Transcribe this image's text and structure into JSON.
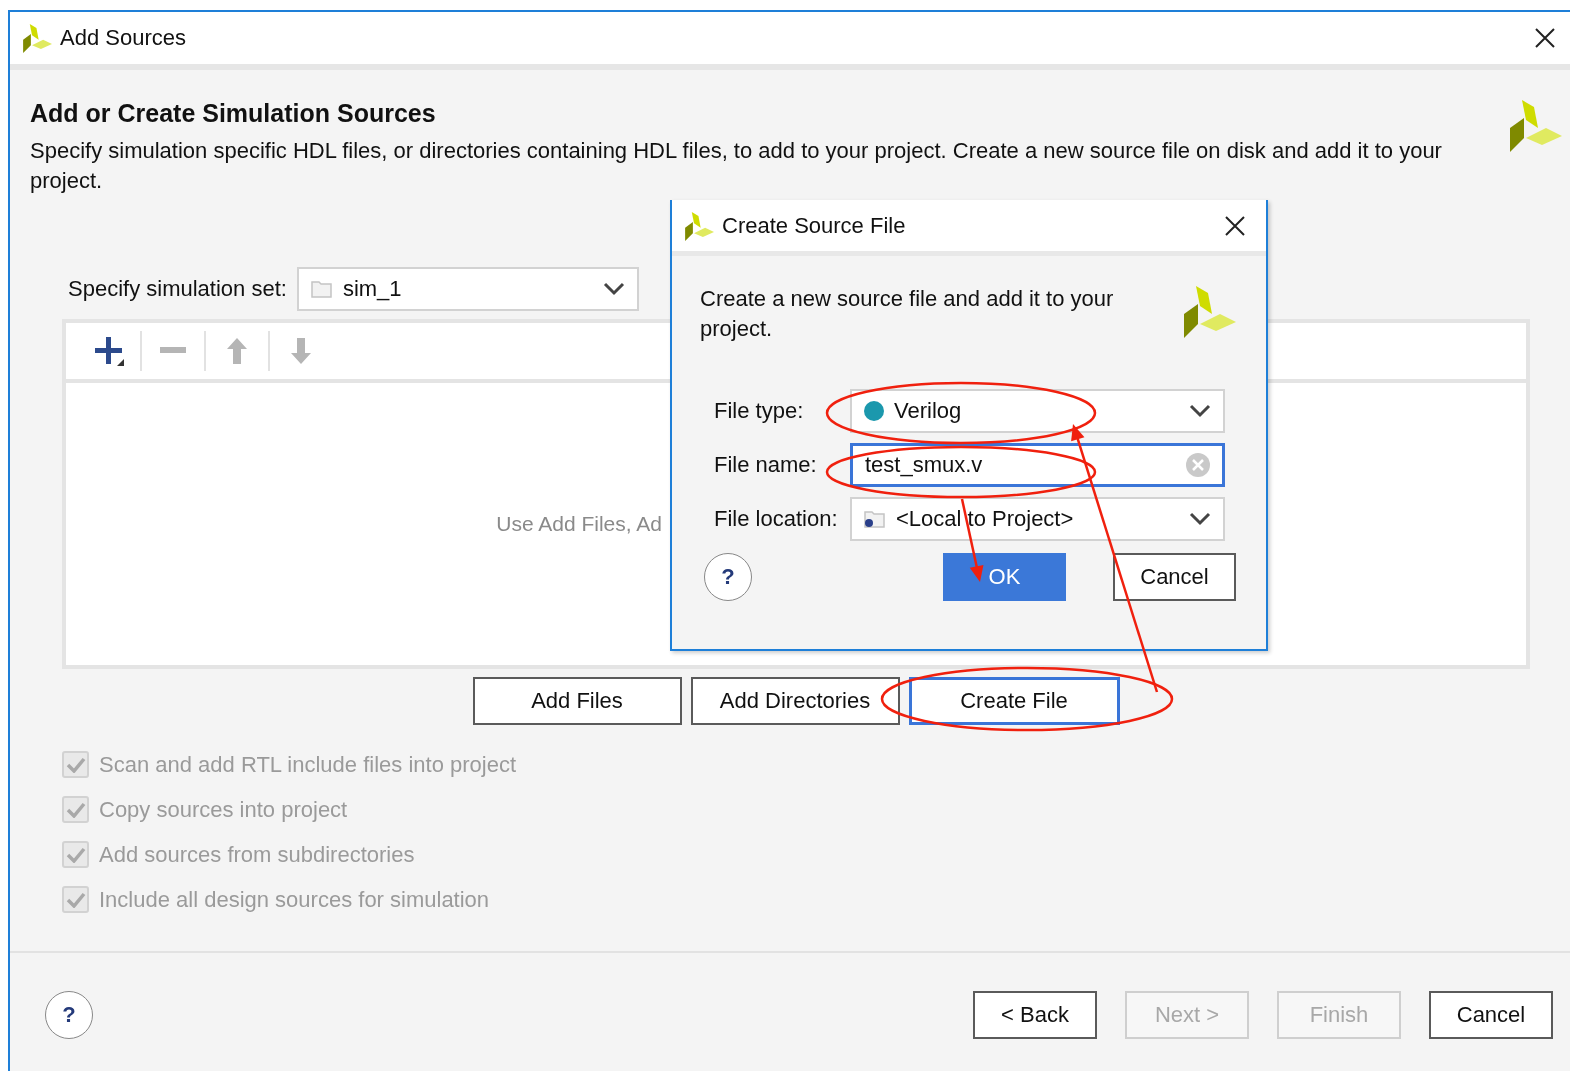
{
  "window": {
    "title": "Add Sources"
  },
  "header": {
    "title": "Add or Create Simulation Sources",
    "description": "Specify simulation specific HDL files, or directories containing HDL files, to add to your project. Create a new source file on disk and add it to your project."
  },
  "simulation_set": {
    "label": "Specify simulation set:",
    "value": "sim_1"
  },
  "toolbar": [
    {
      "kind": "add",
      "disabled": false
    },
    {
      "kind": "remove",
      "disabled": true
    },
    {
      "kind": "up",
      "disabled": true
    },
    {
      "kind": "down",
      "disabled": true
    }
  ],
  "file_list": {
    "hint": "Use Add Files, Ad"
  },
  "file_buttons": [
    {
      "label": "Add Files",
      "focused": false
    },
    {
      "label": "Add Directories",
      "focused": false
    },
    {
      "label": "Create File",
      "focused": true
    }
  ],
  "options": [
    {
      "label": "Scan and add RTL include files into project",
      "checked": true,
      "disabled": true
    },
    {
      "label": "Copy sources into project",
      "checked": true,
      "disabled": true
    },
    {
      "label": "Add sources from subdirectories",
      "checked": true,
      "disabled": true
    },
    {
      "label": "Include all design sources for simulation",
      "checked": true,
      "disabled": true
    }
  ],
  "footer": {
    "help": "?",
    "buttons": [
      {
        "label": "< Back",
        "disabled": false
      },
      {
        "label": "Next >",
        "disabled": true
      },
      {
        "label": "Finish",
        "disabled": true
      },
      {
        "label": "Cancel",
        "disabled": false
      }
    ]
  },
  "dialog": {
    "title": "Create Source File",
    "description": "Create a new source file and add it to your project.",
    "fields": [
      {
        "kind": "type",
        "label": "File type:",
        "value": "Verilog",
        "focused": false
      },
      {
        "kind": "text",
        "label": "File name:",
        "value": "test_smux.v",
        "focused": true
      },
      {
        "kind": "location",
        "label": "File location:",
        "value": "<Local to Project>",
        "focused": false
      }
    ],
    "help": "?",
    "buttons": [
      {
        "label": "OK",
        "primary": true
      },
      {
        "label": "Cancel",
        "primary": false
      }
    ]
  }
}
